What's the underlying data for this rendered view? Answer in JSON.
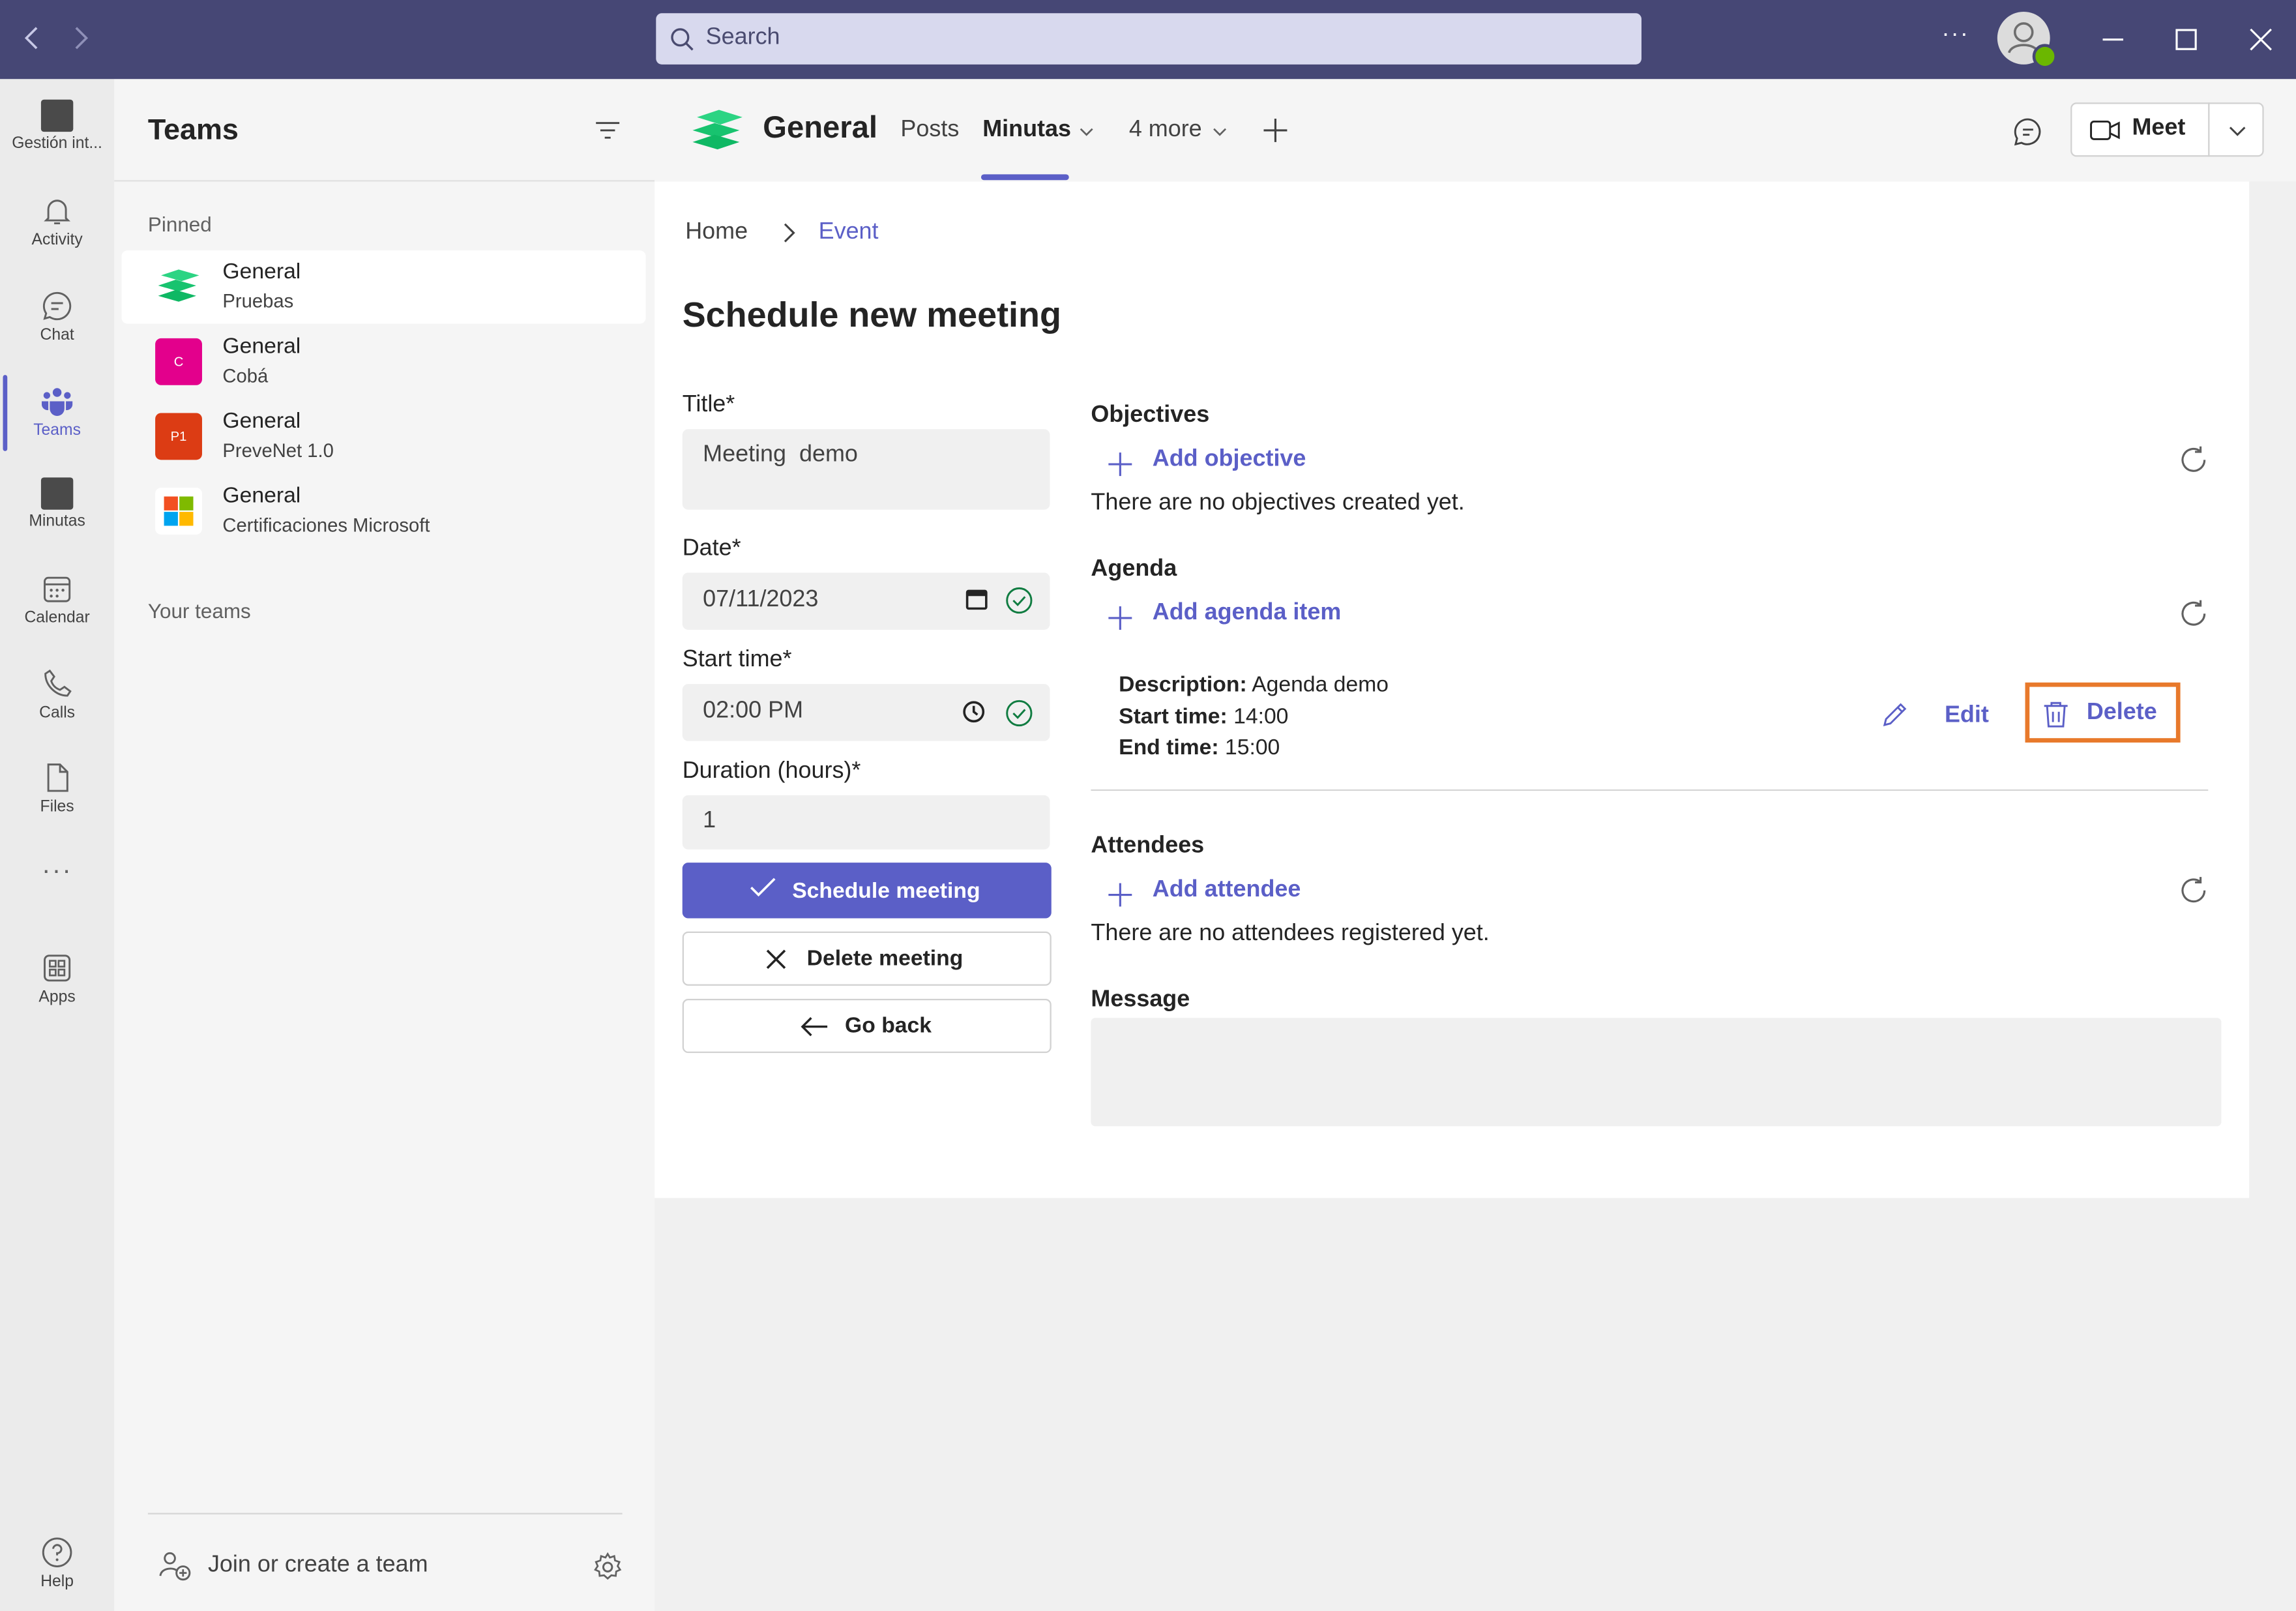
{
  "titlebar": {
    "search_placeholder": "Search",
    "more": "···"
  },
  "rail": {
    "items": [
      {
        "label": "Gestión int...",
        "icon": "app-square-icon"
      },
      {
        "label": "Activity",
        "icon": "bell-icon"
      },
      {
        "label": "Chat",
        "icon": "chat-icon"
      },
      {
        "label": "Teams",
        "icon": "teams-icon"
      },
      {
        "label": "Minutas",
        "icon": "app-square-icon"
      },
      {
        "label": "Calendar",
        "icon": "calendar-icon"
      },
      {
        "label": "Calls",
        "icon": "phone-icon"
      },
      {
        "label": "Files",
        "icon": "file-icon"
      },
      {
        "label": "···",
        "icon": "more-icon"
      },
      {
        "label": "Apps",
        "icon": "apps-icon"
      },
      {
        "label": "Help",
        "icon": "help-icon"
      }
    ]
  },
  "teams_pane": {
    "title": "Teams",
    "pinned_label": "Pinned",
    "your_teams_label": "Your teams",
    "join_label": "Join or create a team",
    "channels": [
      {
        "name": "General",
        "team": "Pruebas",
        "badge": ""
      },
      {
        "name": "General",
        "team": "Cobá",
        "badge": "C"
      },
      {
        "name": "General",
        "team": "PreveNet 1.0",
        "badge": "P1"
      },
      {
        "name": "General",
        "team": "Certificaciones Microsoft",
        "badge": ""
      }
    ]
  },
  "header": {
    "channel": "General",
    "tabs": [
      "Posts",
      "Minutas",
      "4 more"
    ],
    "meet_label": "Meet"
  },
  "breadcrumb": {
    "home": "Home",
    "current": "Event"
  },
  "form": {
    "heading": "Schedule new meeting",
    "title_label": "Title*",
    "title_value": "Meeting  demo",
    "date_label": "Date*",
    "date_value": "07/11/2023",
    "start_label": "Start time*",
    "start_value": "02:00 PM",
    "duration_label": "Duration (hours)*",
    "duration_value": "1",
    "schedule_button": "Schedule meeting",
    "delete_button": "Delete meeting",
    "back_button": "Go back"
  },
  "objectives": {
    "heading": "Objectives",
    "add_label": "Add objective",
    "empty": "There are no objectives created yet."
  },
  "agenda": {
    "heading": "Agenda",
    "add_label": "Add agenda item",
    "item": {
      "description_label": "Description:",
      "description": "Agenda demo",
      "start_label": "Start time:",
      "start": "14:00",
      "end_label": "End time:",
      "end": "15:00"
    },
    "edit_label": "Edit",
    "delete_label": "Delete"
  },
  "attendees": {
    "heading": "Attendees",
    "add_label": "Add attendee",
    "empty": "There are no attendees registered yet."
  },
  "message": {
    "heading": "Message",
    "value": ""
  },
  "colors": {
    "titlebar": "#464775",
    "accent": "#5b5fc7",
    "highlight": "#e8792b"
  }
}
